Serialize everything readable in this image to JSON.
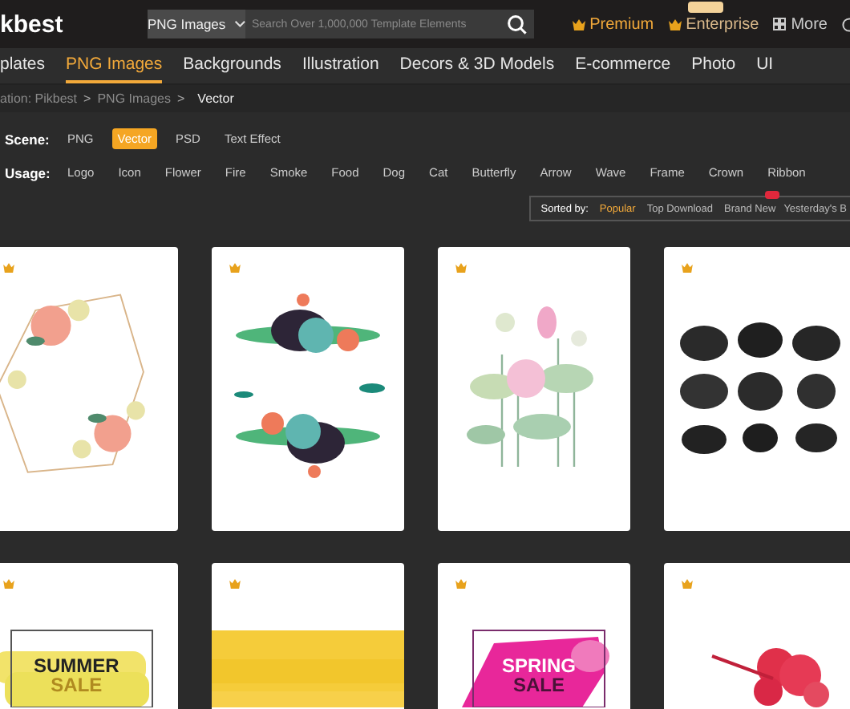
{
  "header": {
    "logo": "kbest",
    "search": {
      "category": "PNG Images",
      "placeholder": "Search Over 1,000,000 Template Elements"
    },
    "links": [
      {
        "label": "Premium",
        "kind": "premium"
      },
      {
        "label": "Enterprise",
        "kind": "enterprise"
      },
      {
        "label": "More",
        "kind": "more"
      }
    ]
  },
  "nav": [
    {
      "label": "plates",
      "selected": false
    },
    {
      "label": "PNG Images",
      "selected": true
    },
    {
      "label": "Backgrounds",
      "selected": false
    },
    {
      "label": "Illustration",
      "selected": false
    },
    {
      "label": "Decors & 3D Models",
      "selected": false
    },
    {
      "label": "E-commerce",
      "selected": false
    },
    {
      "label": "Photo",
      "selected": false
    },
    {
      "label": "UI",
      "selected": false
    }
  ],
  "breadcrumb": {
    "separator": ">",
    "items": [
      "ation: Pikbest",
      "PNG Images",
      "Vector"
    ]
  },
  "filters": [
    {
      "label": "Scene:",
      "options": [
        {
          "label": "PNG",
          "selected": false
        },
        {
          "label": "Vector",
          "selected": true
        },
        {
          "label": "PSD",
          "selected": false
        },
        {
          "label": "Text Effect",
          "selected": false
        }
      ]
    },
    {
      "label": "Usage:",
      "options": [
        {
          "label": "Logo",
          "selected": false
        },
        {
          "label": "Icon",
          "selected": false
        },
        {
          "label": "Flower",
          "selected": false
        },
        {
          "label": "Fire",
          "selected": false
        },
        {
          "label": "Smoke",
          "selected": false
        },
        {
          "label": "Food",
          "selected": false
        },
        {
          "label": "Dog",
          "selected": false
        },
        {
          "label": "Cat",
          "selected": false
        },
        {
          "label": "Butterfly",
          "selected": false
        },
        {
          "label": "Arrow",
          "selected": false
        },
        {
          "label": "Wave",
          "selected": false
        },
        {
          "label": "Frame",
          "selected": false
        },
        {
          "label": "Crown",
          "selected": false
        },
        {
          "label": "Ribbon",
          "selected": false
        }
      ]
    }
  ],
  "sort": {
    "label": "Sorted by:",
    "options": [
      {
        "label": "Popular",
        "selected": true,
        "badge": false
      },
      {
        "label": "Top Download",
        "selected": false,
        "badge": false
      },
      {
        "label": "Brand New",
        "selected": false,
        "badge": true
      },
      {
        "label": "Yesterday's B",
        "selected": false,
        "badge": false
      }
    ]
  },
  "cards": [
    {
      "kind": "wreath",
      "premium": true
    },
    {
      "kind": "bouquet",
      "premium": true
    },
    {
      "kind": "lotus",
      "premium": true
    },
    {
      "kind": "ink",
      "premium": true
    },
    {
      "kind": "summer",
      "premium": true,
      "title": "SUMMER",
      "subtitle": "SALE"
    },
    {
      "kind": "yellow",
      "premium": true
    },
    {
      "kind": "spring",
      "premium": true,
      "title": "SPRING",
      "subtitle": "SALE"
    },
    {
      "kind": "hibiscus",
      "premium": true
    }
  ]
}
